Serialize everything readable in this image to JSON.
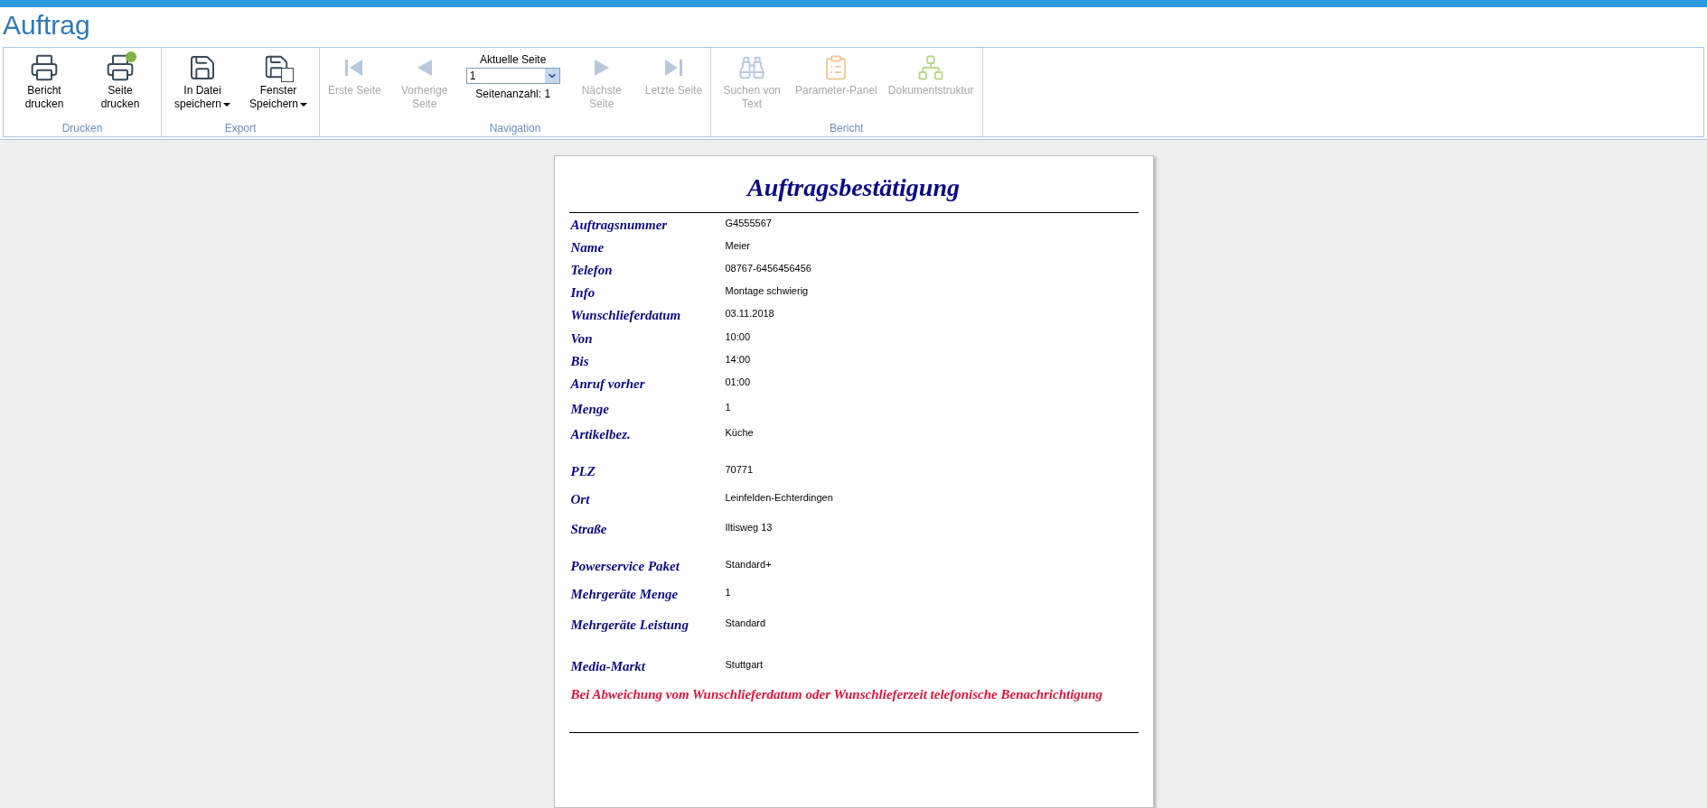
{
  "window": {
    "title": "Auftrag"
  },
  "toolbar": {
    "groups": [
      {
        "label": "Drucken",
        "items": [
          {
            "kind": "button",
            "label": "Bericht drucken",
            "dropdown": false,
            "disabled": false
          },
          {
            "kind": "button",
            "label": "Seite drucken",
            "dropdown": false,
            "disabled": false
          }
        ]
      },
      {
        "label": "Export",
        "items": [
          {
            "kind": "button",
            "label": "In Datei speichern",
            "dropdown": true,
            "disabled": false
          },
          {
            "kind": "button",
            "label": "Fenster Speichern",
            "dropdown": true,
            "disabled": false
          }
        ]
      },
      {
        "label": "Navigation",
        "items": [
          {
            "kind": "button",
            "label": "Erste Seite",
            "dropdown": false,
            "disabled": true
          },
          {
            "kind": "button",
            "label": "Vorherige Seite",
            "dropdown": false,
            "disabled": true
          },
          {
            "kind": "pager",
            "label": "Aktuelle Seite",
            "value": "1",
            "count": "Seitenanzahl: 1"
          },
          {
            "kind": "button",
            "label": "Nächste Seite",
            "dropdown": false,
            "disabled": true
          },
          {
            "kind": "button",
            "label": "Letzte Seite",
            "dropdown": false,
            "disabled": true
          }
        ]
      },
      {
        "label": "Bericht",
        "items": [
          {
            "kind": "button",
            "label": "Suchen von Text",
            "dropdown": false,
            "disabled": true
          },
          {
            "kind": "button",
            "label": "Parameter-Panel",
            "dropdown": false,
            "disabled": true
          },
          {
            "kind": "button",
            "label": "Dokumentstruktur",
            "dropdown": false,
            "disabled": true
          }
        ]
      }
    ]
  },
  "report": {
    "title": "Auftragsbestätigung",
    "fields": [
      {
        "label": "Auftragsnummer",
        "value": "G4555567"
      },
      {
        "label": "Name",
        "value": "Meier"
      },
      {
        "label": "Telefon",
        "value": "08767-6456456456"
      },
      {
        "label": "Info",
        "value": "Montage schwierig"
      },
      {
        "label": "Wunschlieferdatum",
        "value": "03.11.2018"
      },
      {
        "label": "Von",
        "value": "10:00"
      },
      {
        "label": "Bis",
        "value": "14:00"
      },
      {
        "label": "Anruf vorher",
        "value": "01:00"
      },
      {
        "label": "Menge",
        "value": "1"
      },
      {
        "label": "Artikelbez.",
        "value": "Küche"
      },
      {
        "label": "PLZ",
        "value": "70771"
      },
      {
        "label": "Ort",
        "value": "Leinfelden-Echterdingen"
      },
      {
        "label": "Straße",
        "value": "Iltisweg 13"
      },
      {
        "label": "Powerservice Paket",
        "value": "Standard+"
      },
      {
        "label": "Mehrgeräte Menge",
        "value": "1"
      },
      {
        "label": "Mehrgeräte Leistung",
        "value": "Standard"
      },
      {
        "label": "Media-Markt",
        "value": "Stuttgart"
      }
    ],
    "note": "Bei Abweichung vom Wunschlieferdatum oder Wunschlieferzeit telefonische Benachrichtigung"
  }
}
